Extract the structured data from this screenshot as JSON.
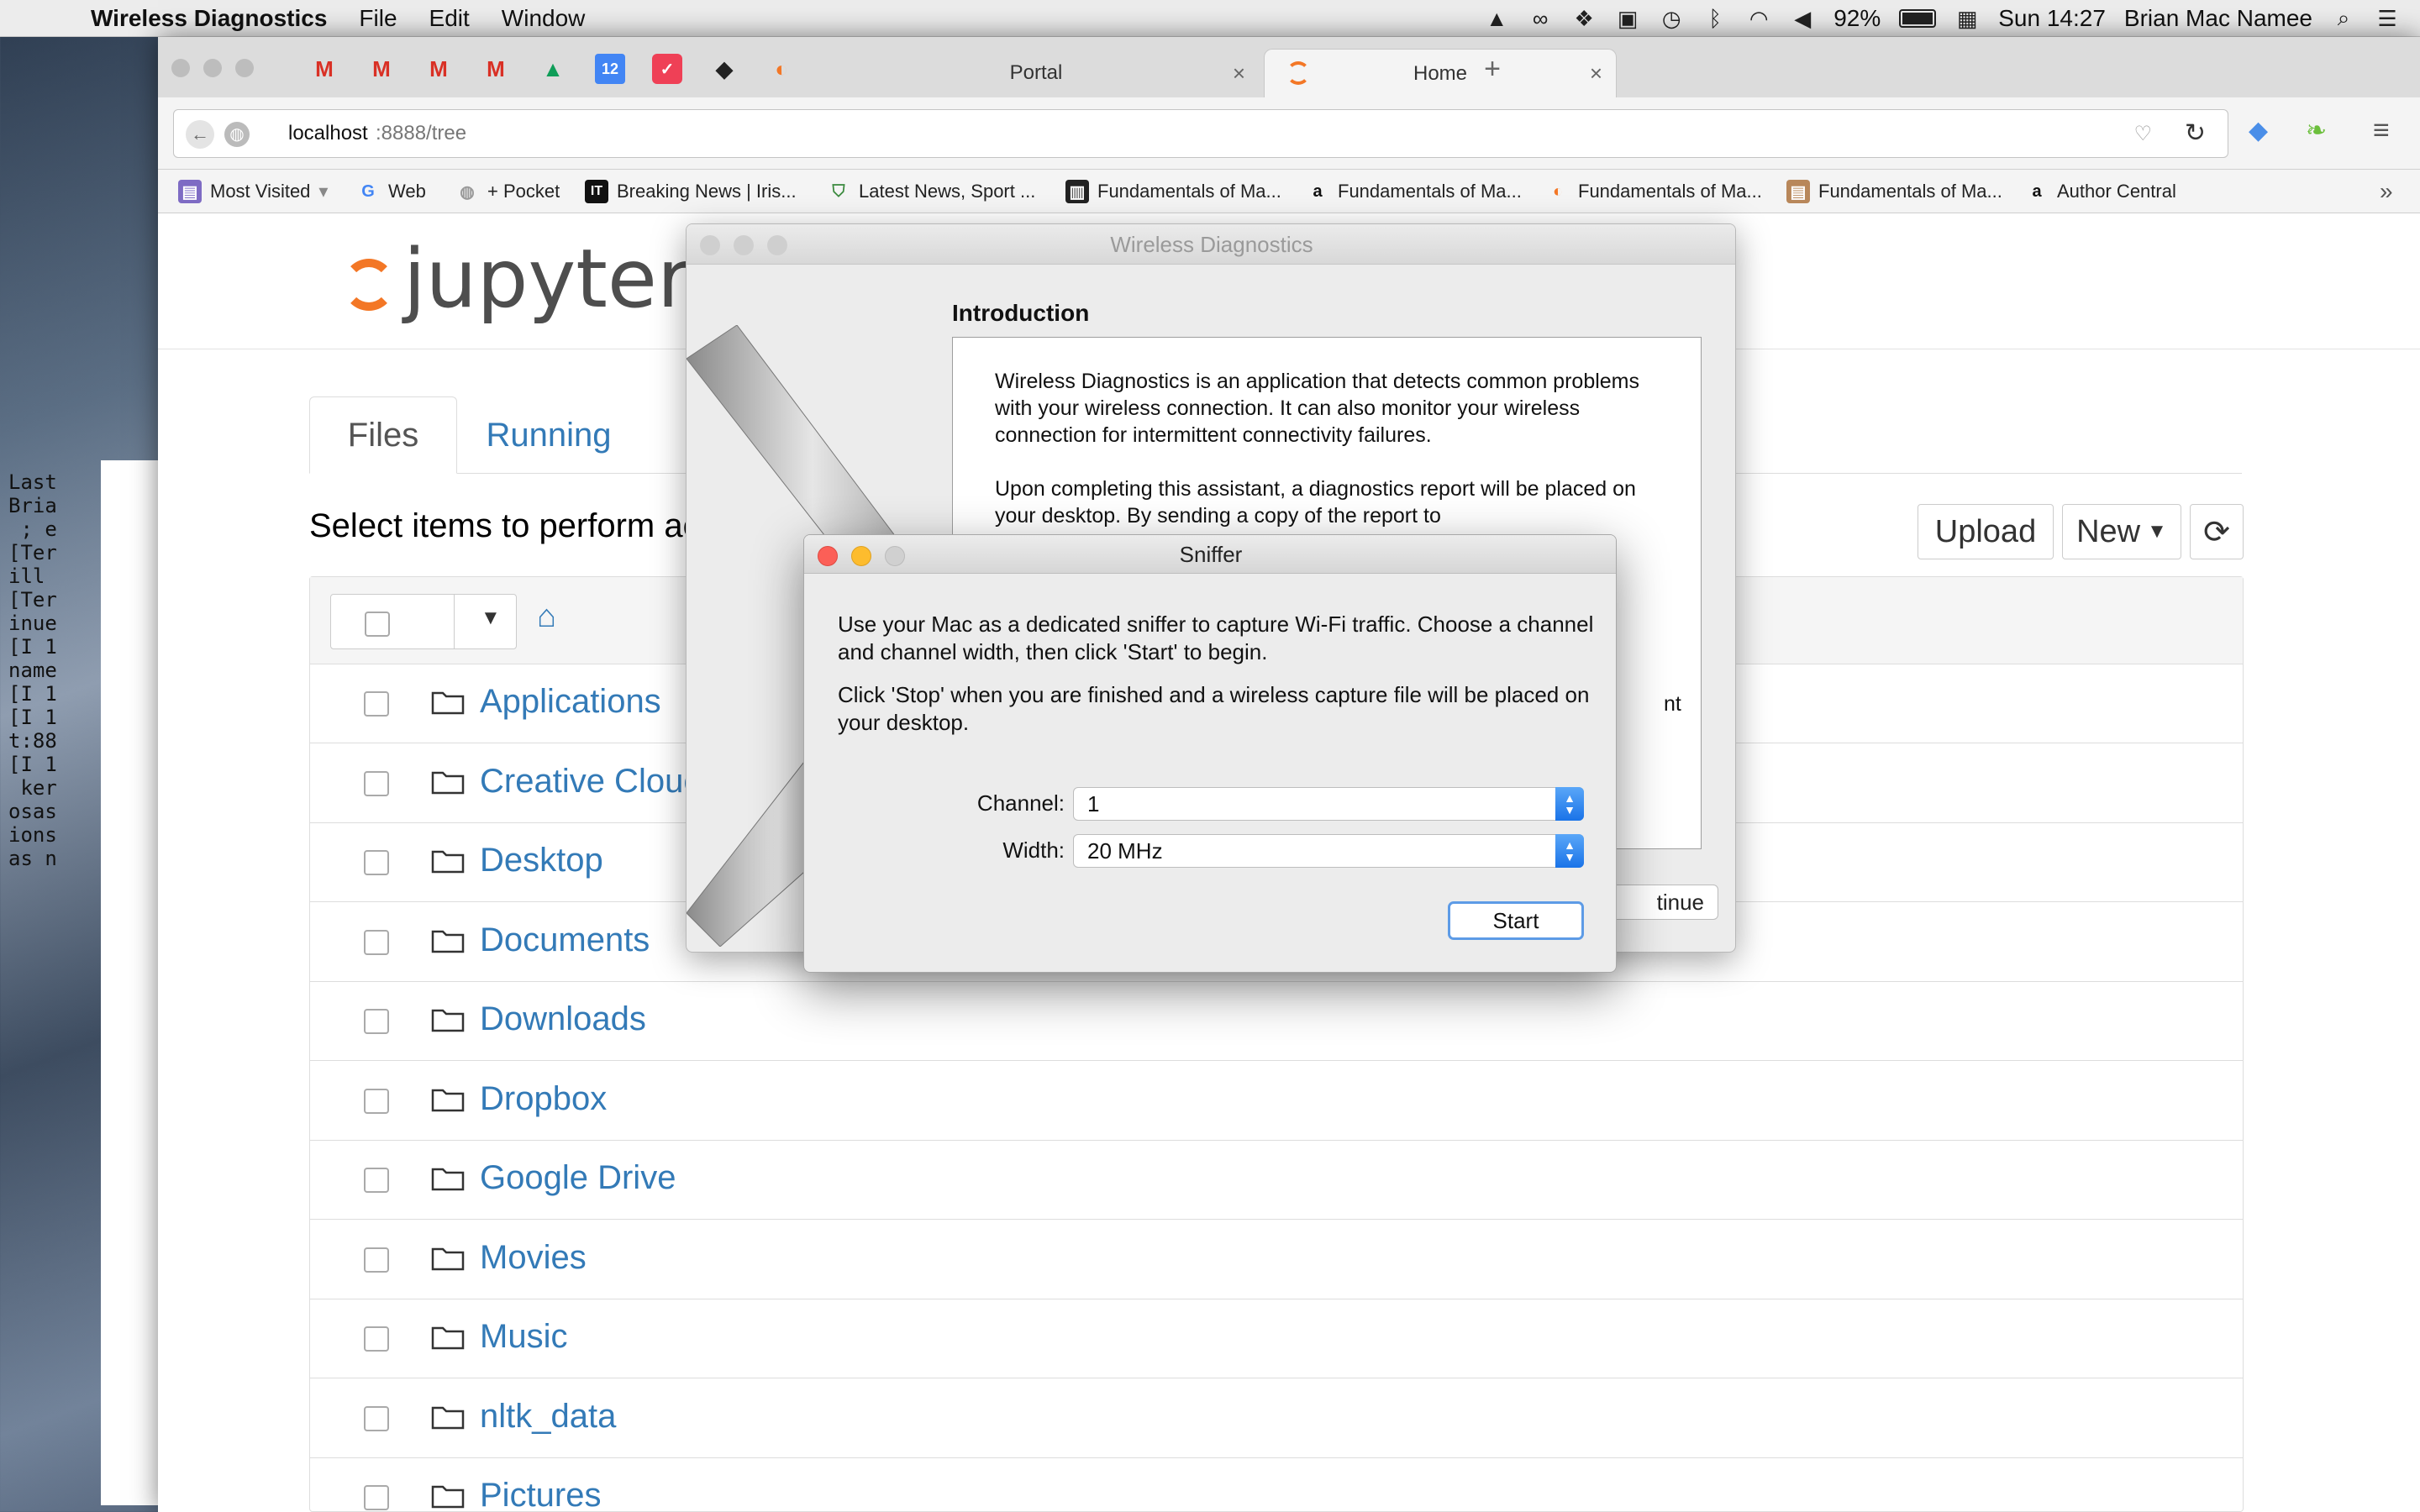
{
  "menubar": {
    "app_name": "Wireless Diagnostics",
    "menus": [
      "File",
      "Edit",
      "Window"
    ],
    "battery": "92%",
    "clock": "Sun 14:27",
    "user": "Brian Mac Namee"
  },
  "browser": {
    "tabs": [
      {
        "label": "Portal",
        "close": "×"
      },
      {
        "label": "Home",
        "close": "×"
      }
    ],
    "new_tab": "+",
    "url_host": "localhost",
    "url_rest": ":8888/tree",
    "bookmarks": [
      "Most Visited",
      "Web",
      "+ Pocket",
      "Breaking News | Iris...",
      "Latest News, Sport ...",
      "Fundamentals of Ma...",
      "Fundamentals of Ma...",
      "Fundamentals of Ma...",
      "Fundamentals of Ma...",
      "Author Central"
    ]
  },
  "jupyter": {
    "logo": "jupyter",
    "tabs": {
      "files": "Files",
      "running": "Running"
    },
    "select_text": "Select items to perform ac",
    "upload": "Upload",
    "new": "New",
    "items": [
      "Applications",
      "Creative Clouc",
      "Desktop",
      "Documents",
      "Downloads",
      "Dropbox",
      "Google Drive",
      "Movies",
      "Music",
      "nltk_data",
      "Pictures"
    ]
  },
  "terminal": {
    "lines": "Last\nBria\n ; e\n[Ter\nill \n[Ter\ninue\n[I 1\nname\n[I 1\n[I 1\nt:88\n[I 1\n ker\nosas\nions\nas n"
  },
  "wireless_diagnostics": {
    "title": "Wireless Diagnostics",
    "heading": "Introduction",
    "para1": "Wireless Diagnostics is an application that detects common problems with your wireless connection. It can also monitor your wireless connection for intermittent connectivity failures.",
    "para2": "Upon completing this assistant, a diagnostics report will be placed on your desktop. By sending a copy of the report to",
    "right_fragment": "nt",
    "continue": "tinue"
  },
  "sniffer": {
    "title": "Sniffer",
    "text1": "Use your Mac as a dedicated sniffer to capture Wi-Fi traffic.  Choose a channel and channel width, then click 'Start' to begin.",
    "text2": "Click 'Stop' when you are finished and a wireless capture file will be placed on your desktop.",
    "channel_label": "Channel:",
    "channel_value": "1",
    "width_label": "Width:",
    "width_value": "20 MHz",
    "start": "Start"
  }
}
